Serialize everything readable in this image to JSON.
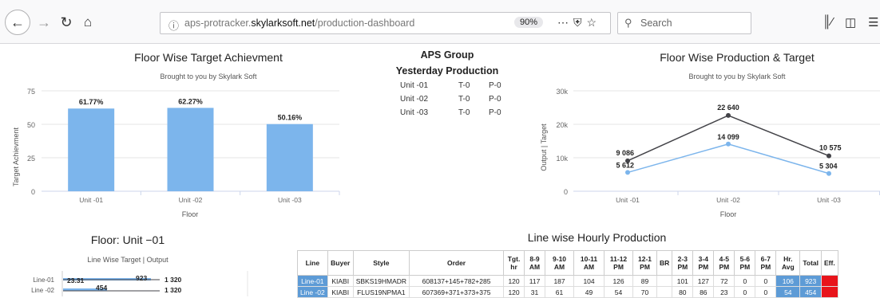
{
  "browser": {
    "url_prefix": "aps-protracker.",
    "url_domain": "skylarksoft.net",
    "url_path": "/production-dashboard",
    "zoom": "90%",
    "search_placeholder": "Search"
  },
  "left_chart": {
    "title": "Floor Wise Target Achievment",
    "subtitle": "Brought to you by Skylark Soft",
    "ylabel": "Target Achievment",
    "xlabel": "Floor",
    "y_ticks": [
      "75",
      "50",
      "25",
      "0"
    ]
  },
  "aps": {
    "title": "APS Group",
    "subtitle": "Yesterday Production",
    "rows": [
      {
        "unit": "Unit -01",
        "t": "T-0",
        "p": "P-0"
      },
      {
        "unit": "Unit -02",
        "t": "T-0",
        "p": "P-0"
      },
      {
        "unit": "Unit -03",
        "t": "T-0",
        "p": "P-0"
      }
    ]
  },
  "right_chart": {
    "title": "Floor Wise Production & Target",
    "subtitle": "Brought to you by Skylark Soft",
    "ylabel": "Output | Target",
    "xlabel": "Floor",
    "y_ticks": [
      "30k",
      "20k",
      "10k",
      "0"
    ]
  },
  "floor_chart": {
    "title": "Floor: Unit −01",
    "subtitle": "Line Wise Target | Output",
    "rows": [
      {
        "label": "Line-01",
        "v1": "23.31",
        "v2": "923",
        "v3": "1 320"
      },
      {
        "label": "Line -02",
        "v1": "",
        "v2": "454",
        "v3": "1 320"
      }
    ]
  },
  "table": {
    "title": "Line wise Hourly Production",
    "headers": [
      "Line",
      "Buyer",
      "Style",
      "Order",
      "Tgt. hr",
      "8-9 AM",
      "9-10 AM",
      "10-11 AM",
      "11-12 PM",
      "12-1 PM",
      "BR",
      "2-3 PM",
      "3-4 PM",
      "4-5 PM",
      "5-6 PM",
      "6-7 PM",
      "Hr. Avg",
      "Total",
      "Eff."
    ],
    "rows": [
      [
        "Line-01",
        "KIABI",
        "SBKS19HMADR",
        "608137+145+782+285",
        "120",
        "117",
        "187",
        "104",
        "126",
        "89",
        "",
        "101",
        "127",
        "72",
        "0",
        "0",
        "106",
        "923",
        ""
      ],
      [
        "Line -02",
        "KIABI",
        "FLUS19NPMA1",
        "607369+371+373+375",
        "120",
        "31",
        "61",
        "49",
        "54",
        "70",
        "",
        "80",
        "86",
        "23",
        "0",
        "0",
        "54",
        "454",
        ""
      ]
    ]
  },
  "chart_data": [
    {
      "type": "bar",
      "title": "Floor Wise Target Achievment",
      "subtitle": "Brought to you by Skylark Soft",
      "xlabel": "Floor",
      "ylabel": "Target Achievment",
      "categories": [
        "Unit -01",
        "Unit -02",
        "Unit -03"
      ],
      "values": [
        61.77,
        62.27,
        50.16
      ],
      "data_labels": [
        "61.77%",
        "62.27%",
        "50.16%"
      ],
      "ylim": [
        0,
        75
      ],
      "color": "#7cb5ec"
    },
    {
      "type": "line",
      "title": "Floor Wise Production & Target",
      "subtitle": "Brought to you by Skylark Soft",
      "xlabel": "Floor",
      "ylabel": "Output | Target",
      "categories": [
        "Unit -01",
        "Unit -02",
        "Unit -03"
      ],
      "series": [
        {
          "values": [
            9086,
            22640,
            10575
          ],
          "labels": [
            "9 086",
            "22 640",
            "10 575"
          ],
          "color": "#434348"
        },
        {
          "values": [
            5612,
            14099,
            5304
          ],
          "labels": [
            "5 612",
            "14 099",
            "5 304"
          ],
          "color": "#7cb5ec"
        }
      ],
      "ylim": [
        0,
        30000
      ]
    }
  ]
}
